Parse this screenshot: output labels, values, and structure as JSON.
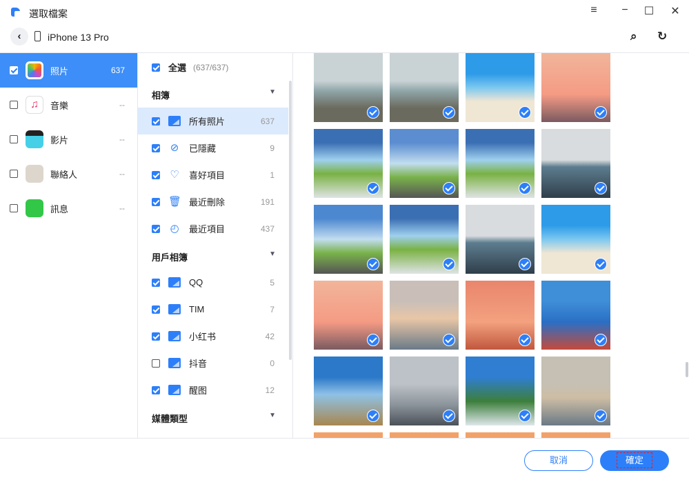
{
  "window": {
    "title": "選取檔案"
  },
  "header": {
    "device": "iPhone 13 Pro"
  },
  "categories": [
    {
      "label": "照片",
      "count": "637",
      "checked": true,
      "active": true
    },
    {
      "label": "音樂",
      "count": "--",
      "checked": false
    },
    {
      "label": "影片",
      "count": "--",
      "checked": false
    },
    {
      "label": "聯絡人",
      "count": "--",
      "checked": false
    },
    {
      "label": "訊息",
      "count": "--",
      "checked": false
    }
  ],
  "albums": {
    "select_all": "全選",
    "select_all_count": "(637/637)",
    "section_albums": "相簿",
    "items": [
      {
        "label": "所有照片",
        "count": "637",
        "icon": "photo-icon"
      },
      {
        "label": "已隱藏",
        "count": "9",
        "icon": "eye-off-icon"
      },
      {
        "label": "喜好項目",
        "count": "1",
        "icon": "heart-icon"
      },
      {
        "label": "最近刪除",
        "count": "191",
        "icon": "trash-icon"
      },
      {
        "label": "最近項目",
        "count": "437",
        "icon": "clock-icon"
      }
    ],
    "section_user": "用戶相簿",
    "user_items": [
      {
        "label": "QQ",
        "count": "5",
        "checked": true
      },
      {
        "label": "TIM",
        "count": "7",
        "checked": true
      },
      {
        "label": "小红书",
        "count": "42",
        "checked": true
      },
      {
        "label": "抖音",
        "count": "0",
        "checked": false
      },
      {
        "label": "醒图",
        "count": "12",
        "checked": true
      }
    ],
    "section_media": "媒體類型"
  },
  "photos_checked": [
    true,
    true,
    true,
    true,
    true,
    true,
    true,
    true,
    true,
    true,
    true,
    true,
    true,
    true,
    true,
    true,
    true,
    true,
    true,
    true,
    true,
    true,
    true,
    true
  ],
  "footer": {
    "cancel": "取消",
    "confirm": "確定"
  },
  "colors": {
    "accent": "#2d7ff9"
  }
}
